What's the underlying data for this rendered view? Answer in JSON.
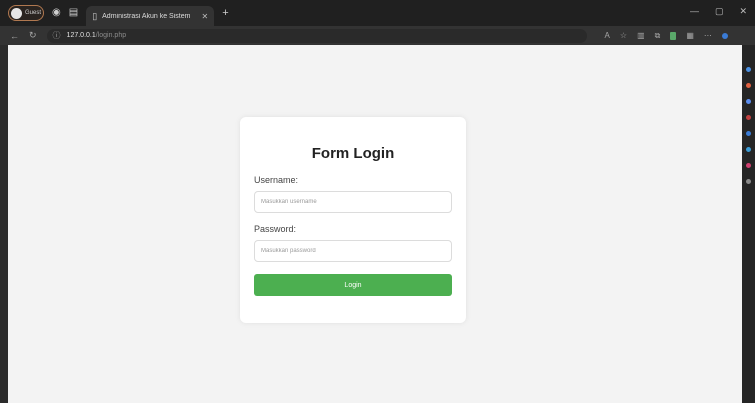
{
  "window": {
    "profile_label": "Guest",
    "tab_title": "Administrasi Akun ke Sistem",
    "address_host": "127.0.0.1",
    "address_path": "/login.php",
    "icons": {
      "new_tab": "plus-icon",
      "minimize": "minimize-icon",
      "maximize": "maximize-icon",
      "close": "close-icon"
    }
  },
  "login": {
    "title": "Form Login",
    "username_label": "Username:",
    "username_placeholder": "Masukkan username",
    "password_label": "Password:",
    "password_placeholder": "Masukkan password",
    "submit_label": "Login",
    "button_color": "#4caf50"
  }
}
